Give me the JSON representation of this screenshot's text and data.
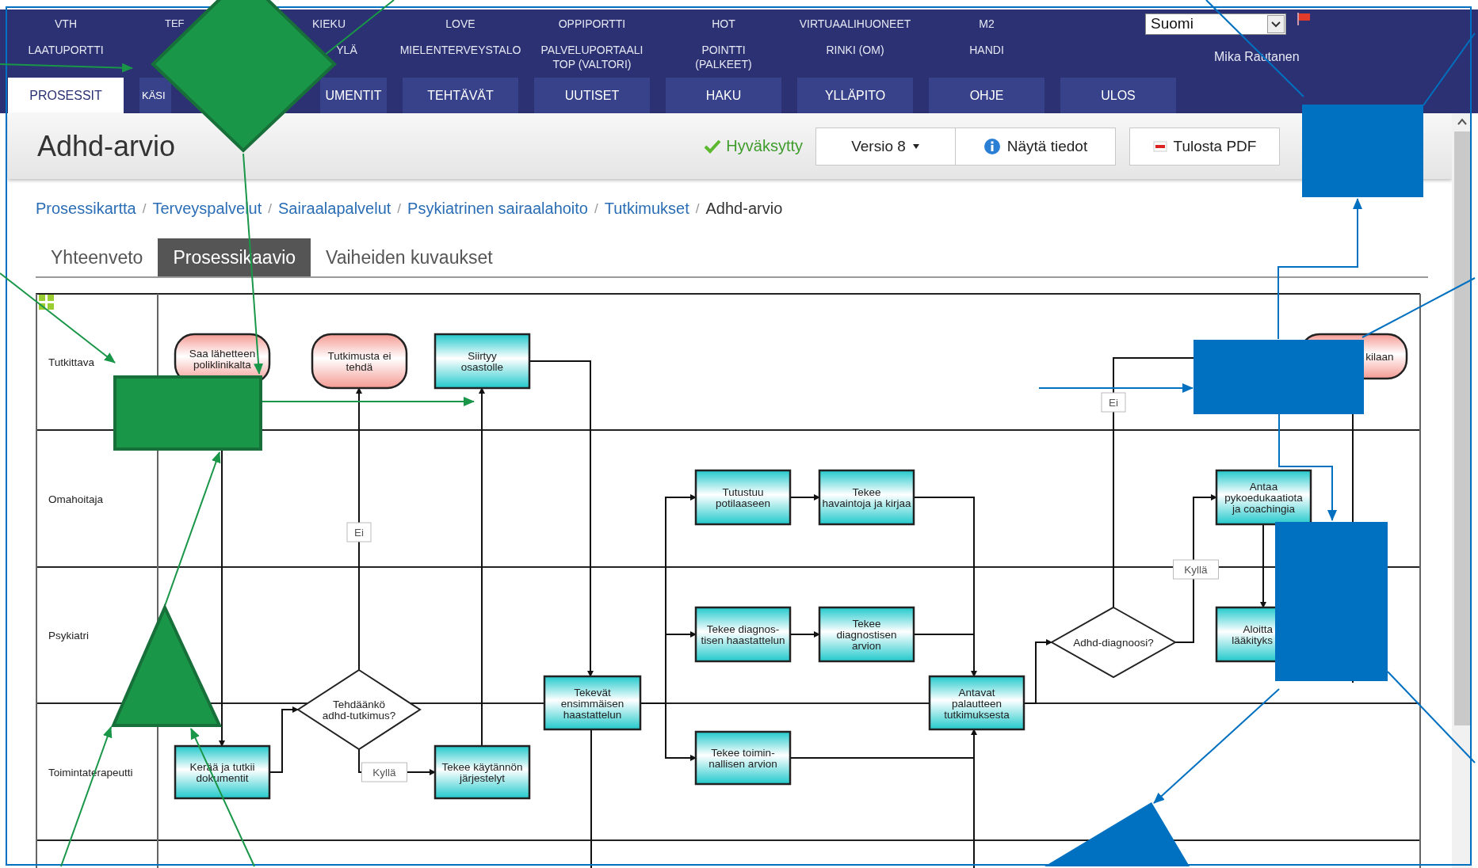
{
  "nav": {
    "links_row_1": [
      "VTH",
      "TEF",
      "KIEKU",
      "LOVE",
      "OPPIPORTTI",
      "HOT",
      "VIRTUAALIHUONEET",
      "M2"
    ],
    "links_row_2": [
      "LAATUPORTTI",
      "YLÄ",
      "MIELENTERVEYSTALO",
      "PALVELUPORTAALI\nTOP (VALTORI)",
      "POINTTI\n(PALKEET)",
      "RINKI (OM)",
      "HANDI"
    ],
    "language": "Suomi",
    "user": "Mika Rautanen",
    "tabs": [
      {
        "label": "PROSESSIT",
        "selected": true
      },
      {
        "label": "KÄSI",
        "selected": false
      },
      {
        "label": "UMENTIT",
        "selected": false
      },
      {
        "label": "TEHTÄVÄT",
        "selected": false
      },
      {
        "label": "UUTISET",
        "selected": false
      },
      {
        "label": "HAKU",
        "selected": false
      },
      {
        "label": "YLLÄPITO",
        "selected": false
      },
      {
        "label": "OHJE",
        "selected": false
      },
      {
        "label": "ULOS",
        "selected": false
      }
    ]
  },
  "page": {
    "title": "Adhd-arvio",
    "status": "Hyväksytty",
    "version_button": "Versio 8",
    "buttons": [
      "Näytä tiedot",
      "Tulosta PDF"
    ]
  },
  "breadcrumbs": {
    "separator": "/",
    "items": [
      {
        "label": "Prosessikartta",
        "current": false
      },
      {
        "label": "Terveyspalvelut",
        "current": false
      },
      {
        "label": "Sairaalapalvelut",
        "current": false
      },
      {
        "label": "Psykiatrinen sairaalahoito",
        "current": false
      },
      {
        "label": "Tutkimukset",
        "current": false
      },
      {
        "label": "Adhd-arvio",
        "current": true
      }
    ]
  },
  "view_tabs": [
    {
      "label": "Yhteenveto",
      "selected": false
    },
    {
      "label": "Prosessikaavio",
      "selected": true
    },
    {
      "label": "Vaiheiden kuvaukset",
      "selected": false
    }
  ],
  "diagram": {
    "lanes": [
      "Tutkittava",
      "Omahoitaja",
      "Psykiatri",
      "Toimintaterapeutti"
    ],
    "nodes": [
      {
        "kind": "terminal",
        "lines": [
          "Saa lähetteen",
          "poliklinikalta"
        ]
      },
      {
        "kind": "terminal",
        "lines": [
          "Tutkimusta ei",
          "tehdä"
        ]
      },
      {
        "kind": "task",
        "lines": [
          "Siirtyy",
          "osastolle"
        ]
      },
      {
        "kind": "task",
        "lines": [
          "Kerää ja tutkii",
          "dokumentit"
        ]
      },
      {
        "kind": "decision",
        "lines": [
          "Tehdäänkö",
          "adhd-tutkimus?"
        ]
      },
      {
        "kind": "task",
        "lines": [
          "Tekee käytännön",
          "järjestelyt"
        ]
      },
      {
        "kind": "task",
        "lines": [
          "Tekevät",
          "ensimmäisen",
          "haastattelun"
        ]
      },
      {
        "kind": "task",
        "lines": [
          "Tutustuu",
          "potilaaseen"
        ]
      },
      {
        "kind": "task",
        "lines": [
          "Tekee",
          "havaintoja ja kirjaa"
        ]
      },
      {
        "kind": "task",
        "lines": [
          "Tekee diagnos-",
          "tisen haastattelun"
        ]
      },
      {
        "kind": "task",
        "lines": [
          "Tekee",
          "diagnostisen",
          "arvion"
        ]
      },
      {
        "kind": "task",
        "lines": [
          "Tekee toimin-",
          "nallisen arvion"
        ]
      },
      {
        "kind": "task",
        "lines": [
          "Antavat",
          "palautteen",
          "tutkimuksesta"
        ]
      },
      {
        "kind": "decision",
        "lines": [
          "Adhd-diagnoosi?"
        ]
      },
      {
        "kind": "task",
        "lines": [
          "Antaa",
          "pykoedukaatiota",
          "ja coachingia"
        ]
      },
      {
        "kind": "task",
        "lines": [
          "Aloitta",
          "lääkityks"
        ]
      },
      {
        "kind": "terminal",
        "lines": [
          "kilaan"
        ]
      }
    ],
    "labels": [
      "Ei",
      "Kyllä",
      "Ei",
      "Kyllä"
    ]
  }
}
